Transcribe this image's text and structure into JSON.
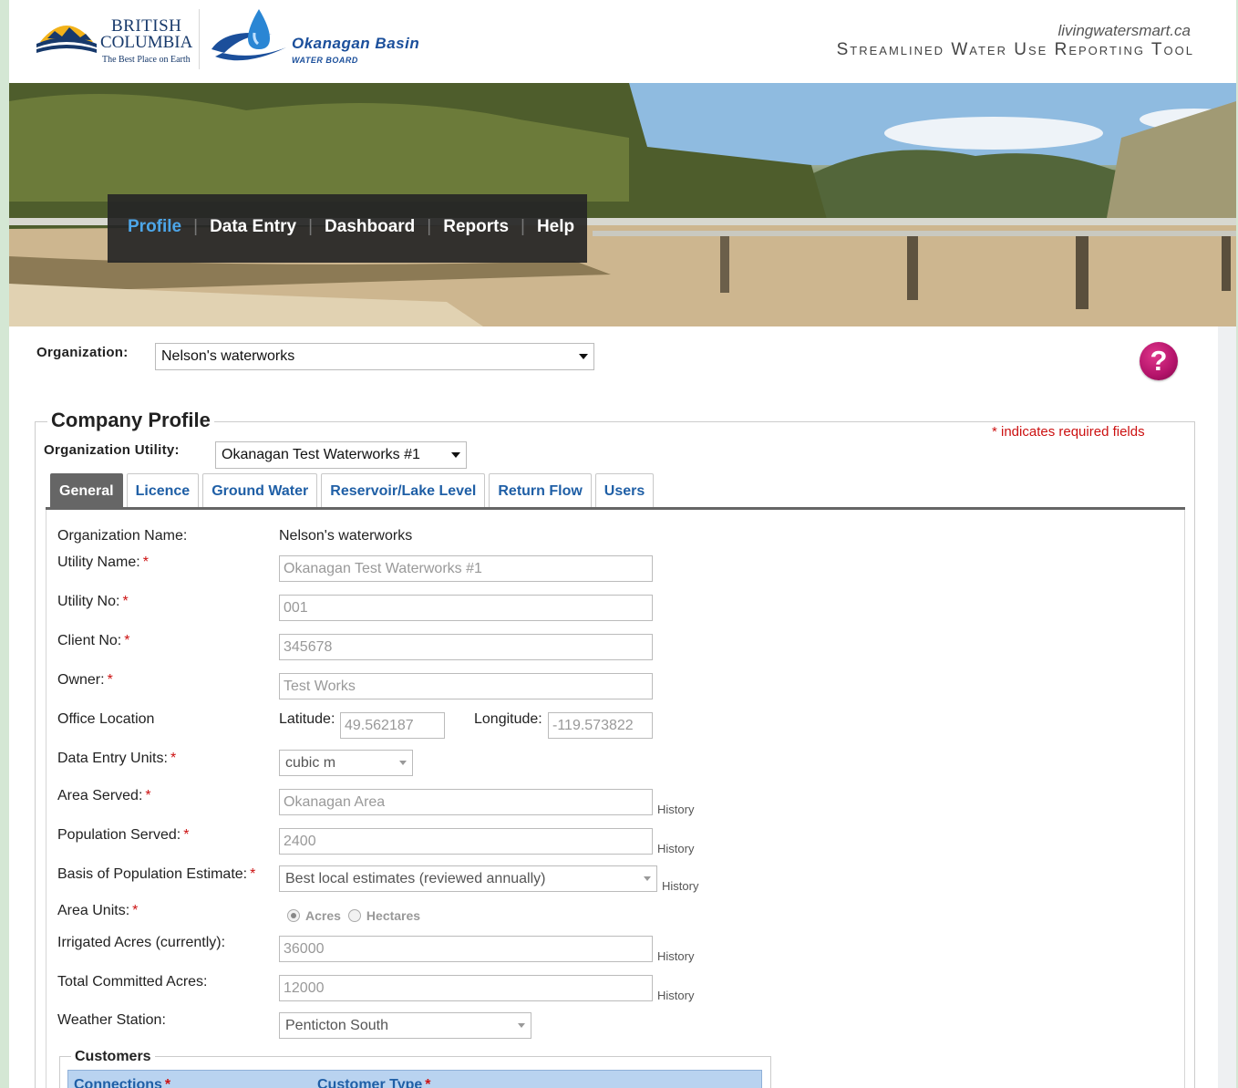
{
  "header": {
    "bc_line1": "BRITISH",
    "bc_line2": "COLUMBIA",
    "bc_tagline": "The Best Place on Earth",
    "okb_title": "Okanagan Basin",
    "okb_sub": "WATER BOARD",
    "site_url": "livingwatersmart.ca",
    "site_title": "Streamlined Water Use Reporting Tool"
  },
  "nav": {
    "items": [
      {
        "label": "Profile",
        "active": true
      },
      {
        "label": "Data Entry"
      },
      {
        "label": "Dashboard"
      },
      {
        "label": "Reports"
      },
      {
        "label": "Help"
      }
    ]
  },
  "organization": {
    "label": "Organization:",
    "selected": "Nelson's waterworks"
  },
  "help": {
    "glyph": "?"
  },
  "profile": {
    "title": "Company Profile",
    "required_note": "* indicates required fields",
    "utility_label": "Organization Utility:",
    "utility_selected": "Okanagan Test Waterworks #1",
    "tabs": [
      "General",
      "Licence",
      "Ground Water",
      "Reservoir/Lake Level",
      "Return Flow",
      "Users"
    ]
  },
  "form": {
    "org_name_label": "Organization Name:",
    "org_name_value": "Nelson's waterworks",
    "utility_name_label": "Utility Name:",
    "utility_name_value": "Okanagan Test Waterworks #1",
    "utility_no_label": "Utility No:",
    "utility_no_value": "001",
    "client_no_label": "Client No:",
    "client_no_value": "345678",
    "owner_label": "Owner:",
    "owner_value": "Test Works",
    "office_label": "Office Location",
    "latitude_label": "Latitude:",
    "latitude_value": "49.562187",
    "longitude_label": "Longitude:",
    "longitude_value": "-119.573822",
    "units_label": "Data Entry Units:",
    "units_value": "cubic m",
    "area_served_label": "Area Served:",
    "area_served_value": "Okanagan Area",
    "population_label": "Population Served:",
    "population_value": "2400",
    "basis_label": "Basis of Population Estimate:",
    "basis_value": "Best local estimates (reviewed annually)",
    "area_units_label": "Area Units:",
    "area_units_option1": "Acres",
    "area_units_option2": "Hectares",
    "irrigated_label": "Irrigated Acres (currently):",
    "irrigated_value": "36000",
    "committed_label": "Total Committed Acres:",
    "committed_value": "12000",
    "weather_label": "Weather Station:",
    "weather_value": "Penticton South",
    "history_label": "History",
    "required_mark": "*"
  },
  "customers": {
    "title": "Customers",
    "col_connections": "Connections",
    "col_type": "Customer Type"
  },
  "colors": {
    "nav_active": "#4da6e8",
    "tab_active_bg": "#666666",
    "link_blue": "#1f5fa6",
    "required_red": "#cc1111",
    "help_magenta": "#b3136a"
  }
}
